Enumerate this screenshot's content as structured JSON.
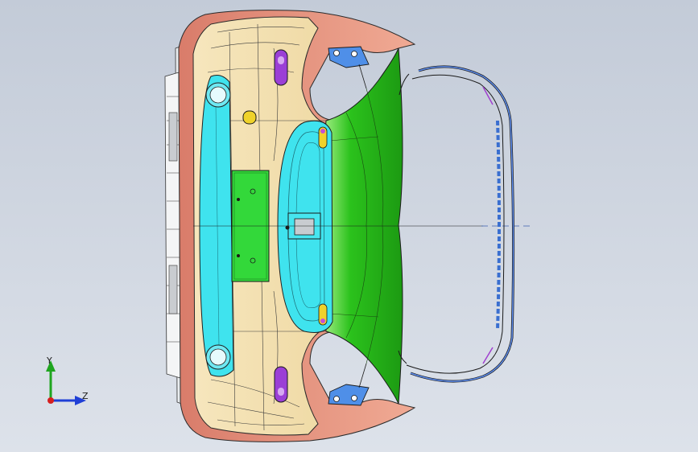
{
  "viewport": {
    "background_top": "#c3cbd8",
    "background_bottom": "#dde2ea"
  },
  "triad": {
    "y_label": "Y",
    "z_label": "Z",
    "y_color": "#1fa51f",
    "z_color": "#1f3fd6",
    "x_color": "#d61f1f"
  },
  "model": {
    "colors": {
      "outer_shell": "#e89a86",
      "cream_face": "#f3e2b4",
      "cyan_panel": "#3fe3ee",
      "green_surface": "#2bc21c",
      "plate_green": "#33d83a",
      "purple_fastener": "#9b3fd6",
      "yellow_fastener": "#efd22a",
      "bracket_blue": "#4f8fe8",
      "edge_line": "#2a2a2a"
    }
  }
}
